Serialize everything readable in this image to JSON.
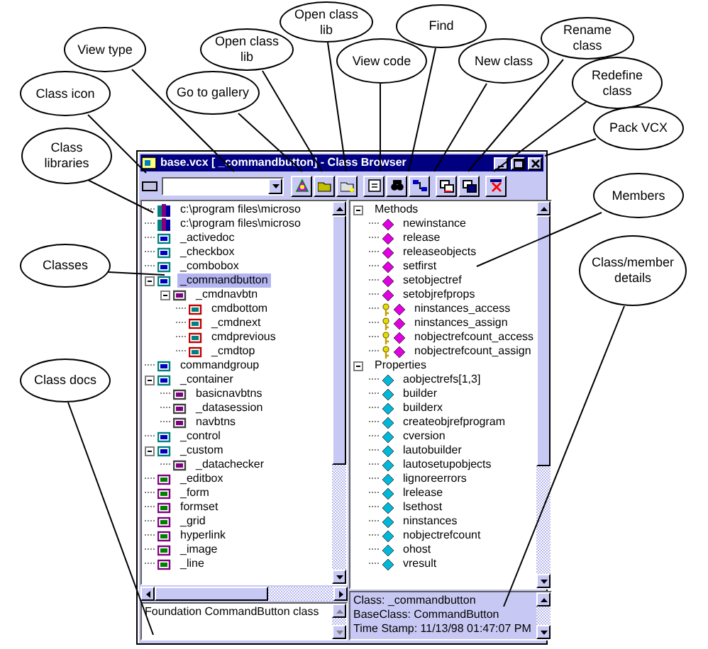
{
  "window": {
    "title": "base.vcx [ _commandbutton] - Class Browser"
  },
  "class_tree": [
    {
      "label": "c:\\program files\\microso",
      "kind": "library",
      "selected": false
    },
    {
      "label": "c:\\program files\\microso",
      "kind": "library",
      "selected": false
    },
    {
      "label": "_activedoc",
      "kind": "class",
      "selected": false
    },
    {
      "label": "_checkbox",
      "kind": "class",
      "selected": false
    },
    {
      "label": "_combobox",
      "kind": "class",
      "selected": false
    },
    {
      "label": "_commandbutton",
      "kind": "class",
      "selected": true,
      "expanded": true,
      "children": [
        {
          "label": "_cmdnavbtn",
          "kind": "class",
          "selected": false,
          "expanded": true,
          "children": [
            {
              "label": "cmdbottom",
              "kind": "class",
              "selected": false
            },
            {
              "label": "_cmdnext",
              "kind": "class",
              "selected": false
            },
            {
              "label": "cmdprevious",
              "kind": "class",
              "selected": false
            },
            {
              "label": "_cmdtop",
              "kind": "class",
              "selected": false
            }
          ]
        }
      ]
    },
    {
      "label": "commandgroup",
      "kind": "class",
      "selected": false
    },
    {
      "label": "_container",
      "kind": "class",
      "selected": false,
      "expanded": true,
      "children": [
        {
          "label": "basicnavbtns",
          "kind": "class",
          "selected": false
        },
        {
          "label": "_datasession",
          "kind": "class",
          "selected": false
        },
        {
          "label": "navbtns",
          "kind": "class",
          "selected": false
        }
      ]
    },
    {
      "label": "_control",
      "kind": "class",
      "selected": false
    },
    {
      "label": "_custom",
      "kind": "class",
      "selected": false,
      "expanded": true,
      "children": [
        {
          "label": "_datachecker",
          "kind": "class",
          "selected": false
        }
      ]
    },
    {
      "label": "_editbox",
      "kind": "class",
      "selected": false
    },
    {
      "label": "_form",
      "kind": "class",
      "selected": false
    },
    {
      "label": "formset",
      "kind": "class",
      "selected": false
    },
    {
      "label": "_grid",
      "kind": "class",
      "selected": false
    },
    {
      "label": "hyperlink",
      "kind": "class",
      "selected": false
    },
    {
      "label": "_image",
      "kind": "class",
      "selected": false
    },
    {
      "label": "_line",
      "kind": "class",
      "selected": false
    }
  ],
  "members": [
    {
      "label": "Methods",
      "kind": "group",
      "expanded": true,
      "children": [
        {
          "label": "newinstance",
          "kind": "method"
        },
        {
          "label": "release",
          "kind": "method"
        },
        {
          "label": "releaseobjects",
          "kind": "method"
        },
        {
          "label": "setfirst",
          "kind": "method"
        },
        {
          "label": "setobjectref",
          "kind": "method"
        },
        {
          "label": "setobjrefprops",
          "kind": "method"
        },
        {
          "label": "ninstances_access",
          "kind": "access_method"
        },
        {
          "label": "ninstances_assign",
          "kind": "access_method"
        },
        {
          "label": "nobjectrefcount_access",
          "kind": "access_method"
        },
        {
          "label": "nobjectrefcount_assign",
          "kind": "access_method"
        }
      ]
    },
    {
      "label": "Properties",
      "kind": "group",
      "expanded": true,
      "children": [
        {
          "label": "aobjectrefs[1,3]",
          "kind": "property"
        },
        {
          "label": "builder",
          "kind": "property"
        },
        {
          "label": "builderx",
          "kind": "property"
        },
        {
          "label": "createobjrefprogram",
          "kind": "property"
        },
        {
          "label": "cversion",
          "kind": "property"
        },
        {
          "label": "lautobuilder",
          "kind": "property"
        },
        {
          "label": "lautosetupobjects",
          "kind": "property"
        },
        {
          "label": "lignoreerrors",
          "kind": "property"
        },
        {
          "label": "lrelease",
          "kind": "property"
        },
        {
          "label": "lsethost",
          "kind": "property"
        },
        {
          "label": "ninstances",
          "kind": "property"
        },
        {
          "label": "nobjectrefcount",
          "kind": "property"
        },
        {
          "label": "ohost",
          "kind": "property"
        },
        {
          "label": "vresult",
          "kind": "property"
        }
      ]
    }
  ],
  "class_docs": "Foundation CommandButton class",
  "details": [
    "Class: _commandbutton",
    "BaseClass: CommandButton",
    "Time Stamp: 11/13/98 01:47:07 PM"
  ],
  "callouts": [
    {
      "text": "Open class lib"
    },
    {
      "text": "Find"
    },
    {
      "text": "View type"
    },
    {
      "text": "Open class lib"
    },
    {
      "text": "View code"
    },
    {
      "text": "New class"
    },
    {
      "text": "Rename class"
    },
    {
      "text": "Class icon"
    },
    {
      "text": "Go to gallery"
    },
    {
      "text": "Redefine class"
    },
    {
      "text": "Pack VCX"
    },
    {
      "text": "Class libraries"
    },
    {
      "text": "Members"
    },
    {
      "text": "Classes"
    },
    {
      "text": "Class/member details"
    },
    {
      "text": "Class docs"
    }
  ]
}
